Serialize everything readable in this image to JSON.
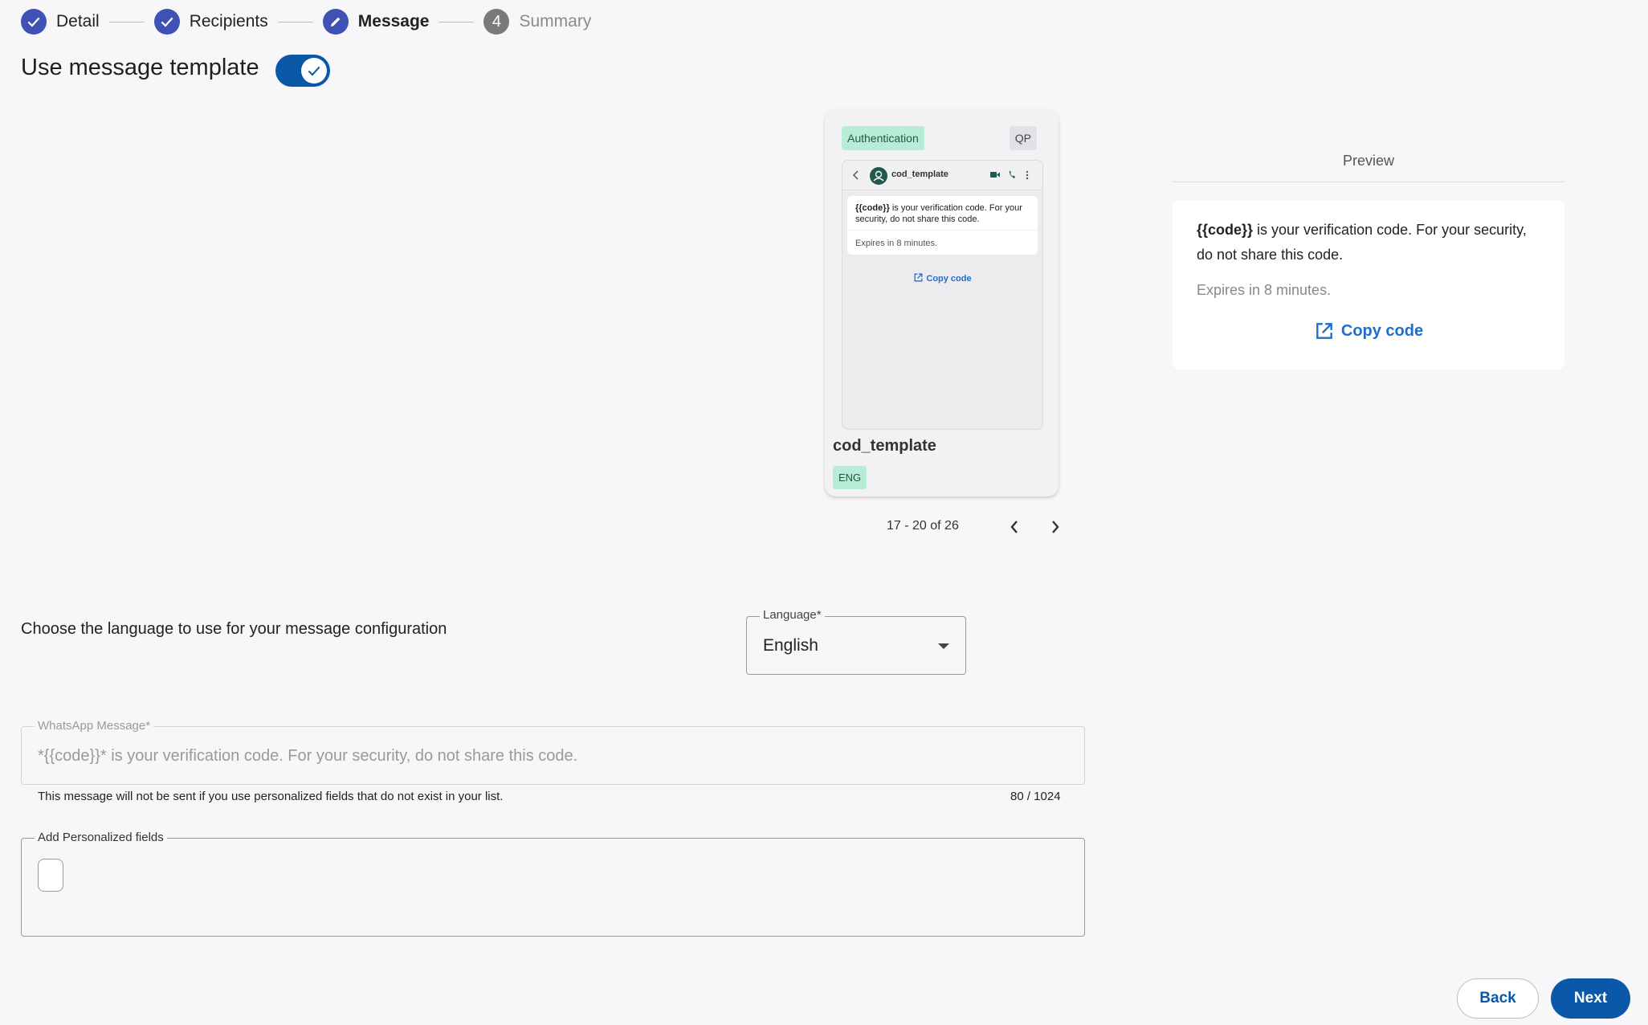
{
  "stepper": {
    "steps": [
      {
        "label": "Detail",
        "state": "done"
      },
      {
        "label": "Recipients",
        "state": "done"
      },
      {
        "label": "Message",
        "state": "active"
      },
      {
        "label": "Summary",
        "state": "pending",
        "number": "4"
      }
    ]
  },
  "template_toggle": {
    "label": "Use message template",
    "on": true
  },
  "template_card": {
    "category": "Authentication",
    "badge": "QP",
    "phone_contact": "cod_template",
    "phone_message_code": "{{code}}",
    "phone_message_rest": " is your verification code. For your security, do not share this code.",
    "phone_footer": "Expires in 8 minutes.",
    "phone_button": "Copy code",
    "name": "cod_template",
    "language_badge": "ENG"
  },
  "pagination": {
    "label": "17 - 20 of 26"
  },
  "preview": {
    "title": "Preview",
    "message_code": "{{code}}",
    "message_rest": " is your verification code. For your security, do not share this code.",
    "footer": "Expires in 8 minutes.",
    "button_label": "Copy code"
  },
  "language": {
    "description": "Choose the language to use for your message configuration",
    "label": "Language*",
    "value": "English"
  },
  "whatsapp_message": {
    "label": "WhatsApp Message*",
    "value": "*{{code}}* is your verification code. For your security, do not share this code.",
    "helper": "This message will not be sent if you use personalized fields that do not exist in your list.",
    "counter": "80 / 1024"
  },
  "personalized_fields": {
    "label": "Add Personalized fields"
  },
  "actions": {
    "back_label": "Back",
    "next_label": "Next"
  },
  "colors": {
    "primary": "#0b57a8",
    "stepper": "#3f51b5",
    "badge_green": "#b9ecd6",
    "link": "#1a6fd0"
  }
}
